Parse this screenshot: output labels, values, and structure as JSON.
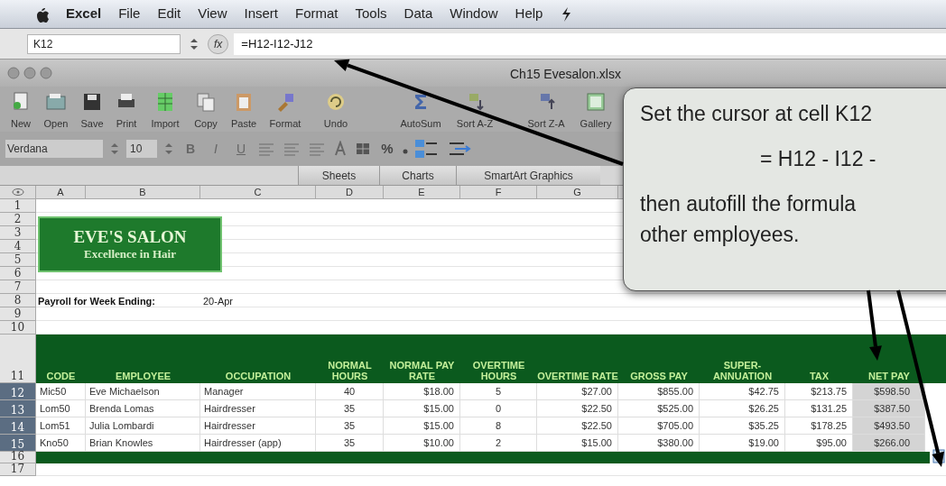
{
  "menu_bar": {
    "items": [
      {
        "label": "Excel",
        "bold": true
      },
      {
        "label": "File",
        "bold": false
      },
      {
        "label": "Edit",
        "bold": false
      },
      {
        "label": "View",
        "bold": false
      },
      {
        "label": "Insert",
        "bold": false
      },
      {
        "label": "Format",
        "bold": false
      },
      {
        "label": "Tools",
        "bold": false
      },
      {
        "label": "Data",
        "bold": false
      },
      {
        "label": "Window",
        "bold": false
      },
      {
        "label": "Help",
        "bold": false
      }
    ]
  },
  "formula_bar": {
    "name_box": "K12",
    "fx": "fx",
    "formula": "=H12-I12-J12"
  },
  "window": {
    "title": "Ch15 Evesalon.xlsx"
  },
  "toolbar": {
    "buttons": [
      "New",
      "Open",
      "Save",
      "Print",
      "Import",
      "Copy",
      "Paste",
      "Format",
      "Undo",
      "AutoSum",
      "Sort A-Z",
      "Sort Z-A",
      "Gallery"
    ]
  },
  "formatting_bar": {
    "font": "Verdana",
    "size": "10",
    "styles": [
      "B",
      "I",
      "U"
    ],
    "percent": "%"
  },
  "ribbon_tabs": [
    "Sheets",
    "Charts",
    "SmartArt Graphics"
  ],
  "columns": [
    "A",
    "B",
    "C",
    "D",
    "E",
    "F",
    "G"
  ],
  "rows": [
    {
      "label": "1",
      "selected": false
    },
    {
      "label": "2",
      "selected": false
    },
    {
      "label": "3",
      "selected": false
    },
    {
      "label": "4",
      "selected": false
    },
    {
      "label": "5",
      "selected": false
    },
    {
      "label": "6",
      "selected": false
    },
    {
      "label": "7",
      "selected": false
    },
    {
      "label": "8",
      "selected": false
    },
    {
      "label": "9",
      "selected": false
    },
    {
      "label": "10",
      "selected": false
    },
    {
      "label": "11",
      "selected": false
    },
    {
      "label": "12",
      "selected": true
    },
    {
      "label": "13",
      "selected": true
    },
    {
      "label": "14",
      "selected": true
    },
    {
      "label": "15",
      "selected": true
    },
    {
      "label": "16",
      "selected": false
    },
    {
      "label": "17",
      "selected": false
    }
  ],
  "logo": {
    "title": "EVE'S SALON",
    "subtitle": "Excellence in Hair"
  },
  "payroll": {
    "label": "Payroll for Week Ending:",
    "value": "20-Apr"
  },
  "table": {
    "columns": [
      "CODE",
      "EMPLOYEE",
      "OCCUPATION",
      "NORMAL HOURS",
      "NORMAL PAY RATE",
      "OVERTIME HOURS",
      "OVERTIME RATE",
      "GROSS PAY",
      "SUPER- ANNUATION",
      "TAX",
      "NET PAY"
    ],
    "rows": [
      {
        "selected": true,
        "cells": [
          "Mic50",
          "Eve Michaelson",
          "Manager",
          "40",
          "$18.00",
          "5",
          "$27.00",
          "$855.00",
          "$42.75",
          "$213.75",
          "$598.50"
        ]
      },
      {
        "selected": true,
        "cells": [
          "Lom50",
          "Brenda Lomas",
          "Hairdresser",
          "35",
          "$15.00",
          "0",
          "$22.50",
          "$525.00",
          "$26.25",
          "$131.25",
          "$387.50"
        ]
      },
      {
        "selected": true,
        "cells": [
          "Lom51",
          "Julia Lombardi",
          "Hairdresser",
          "35",
          "$15.00",
          "8",
          "$22.50",
          "$705.00",
          "$35.25",
          "$178.25",
          "$493.50"
        ]
      },
      {
        "selected": true,
        "cells": [
          "Kno50",
          "Brian Knowles",
          "Hairdresser (app)",
          "35",
          "$10.00",
          "2",
          "$15.00",
          "$380.00",
          "$19.00",
          "$95.00",
          "$266.00"
        ]
      }
    ]
  },
  "callout": {
    "lines": [
      "Set the cursor at cell K12",
      "= H12 - I12 -",
      "then autofill the formula",
      "other employees."
    ]
  }
}
